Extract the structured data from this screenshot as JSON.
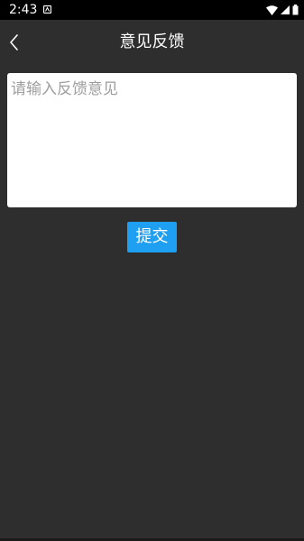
{
  "status_bar": {
    "time": "2:43",
    "icons": {
      "notification": "android-notification-icon",
      "wifi": "wifi-icon",
      "signal": "cell-signal-icon",
      "battery": "battery-icon"
    }
  },
  "app_bar": {
    "title": "意见反馈",
    "back_icon": "chevron-left-icon"
  },
  "feedback": {
    "value": "",
    "placeholder": "请输入反馈意见"
  },
  "submit": {
    "label": "提交"
  },
  "colors": {
    "background": "#2e2e2e",
    "status_bar": "#000000",
    "accent": "#1e9ff2",
    "input_bg": "#ffffff",
    "placeholder": "#9e9e9e"
  }
}
